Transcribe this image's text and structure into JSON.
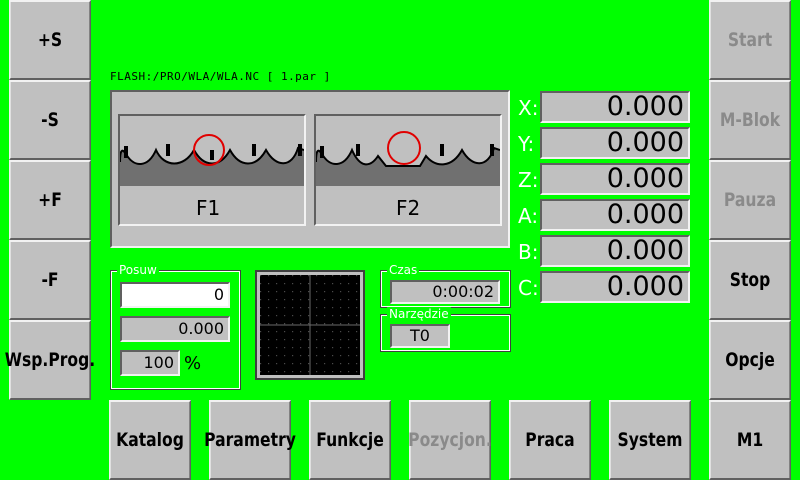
{
  "left_buttons": [
    {
      "label": "+S",
      "disabled": false
    },
    {
      "label": "-S",
      "disabled": false
    },
    {
      "label": "+F",
      "disabled": false
    },
    {
      "label": "-F",
      "disabled": false
    },
    {
      "label": "Wsp.Prog.",
      "disabled": false
    }
  ],
  "right_buttons": [
    {
      "label": "Start",
      "disabled": true
    },
    {
      "label": "M-Blok",
      "disabled": true
    },
    {
      "label": "Pauza",
      "disabled": true
    },
    {
      "label": "Stop",
      "disabled": false
    },
    {
      "label": "Opcje",
      "disabled": false
    }
  ],
  "bottom_buttons": [
    {
      "label": "Katalog",
      "disabled": false
    },
    {
      "label": "Parametry",
      "disabled": false
    },
    {
      "label": "Funkcje",
      "disabled": false
    },
    {
      "label": "Pozycjon.",
      "disabled": true
    },
    {
      "label": "Praca",
      "disabled": false
    },
    {
      "label": "System",
      "disabled": false
    },
    {
      "label": "M1",
      "disabled": false
    }
  ],
  "file_path": "FLASH:/PRO/WLA/WLA.NC [ 1.par ]",
  "figures": {
    "f1": "F1",
    "f2": "F2"
  },
  "axes": [
    {
      "label": "X:",
      "value": "0.000"
    },
    {
      "label": "Y:",
      "value": "0.000"
    },
    {
      "label": "Z:",
      "value": "0.000"
    },
    {
      "label": "A:",
      "value": "0.000"
    },
    {
      "label": "B:",
      "value": "0.000"
    },
    {
      "label": "C:",
      "value": "0.000"
    }
  ],
  "posuw": {
    "title": "Posuw",
    "value1": "0",
    "value2": "0.000",
    "percent": "100",
    "percent_unit": "%"
  },
  "czas": {
    "title": "Czas",
    "value": "0:00:02"
  },
  "narzedzie": {
    "title": "Narzędzie",
    "value": "T0"
  },
  "colors": {
    "background": "#00ff00",
    "button_face": "#c0c0c0",
    "disabled_text": "#8a8a8a"
  }
}
